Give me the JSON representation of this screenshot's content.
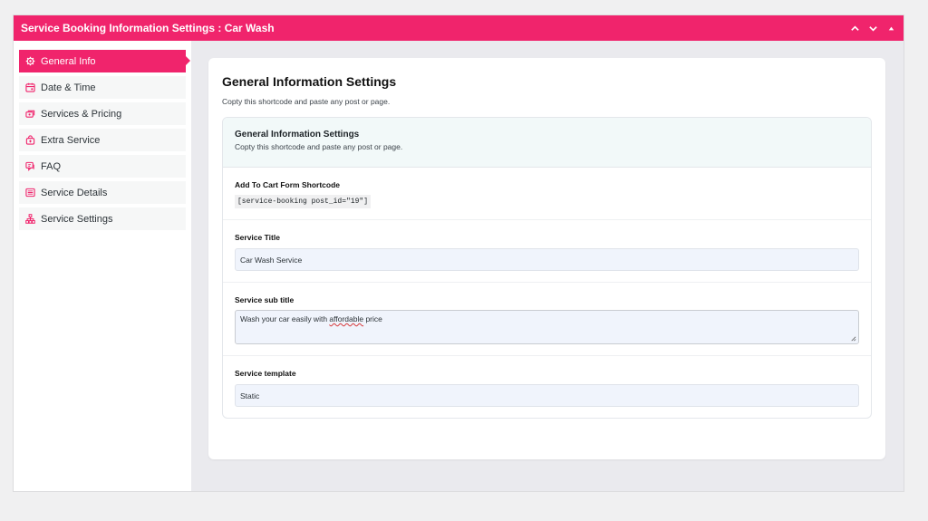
{
  "header": {
    "title": "Service Booking Information Settings : Car Wash",
    "accent": "#f0246c"
  },
  "sidebar": {
    "items": [
      {
        "label": "General Info",
        "icon": "gear-icon",
        "active": true
      },
      {
        "label": "Date & Time",
        "icon": "calendar-icon"
      },
      {
        "label": "Services & Pricing",
        "icon": "money-icon"
      },
      {
        "label": "Extra Service",
        "icon": "bag-icon"
      },
      {
        "label": "FAQ",
        "icon": "faq-icon"
      },
      {
        "label": "Service Details",
        "icon": "list-icon"
      },
      {
        "label": "Service Settings",
        "icon": "sitemap-icon"
      }
    ]
  },
  "card": {
    "title": "General Information Settings",
    "subtitle": "Copty this shortcode and paste any post or page.",
    "inner": {
      "title": "General Information Settings",
      "subtitle": "Copty this shortcode and paste any post or page."
    },
    "shortcode": {
      "label": "Add To Cart Form Shortcode",
      "value": "[service-booking post_id=\"19\"]"
    },
    "service_title": {
      "label": "Service Title",
      "value": "Car Wash Service"
    },
    "service_subtitle": {
      "label": "Service sub title",
      "value_before": "Wash your car easily with ",
      "value_misspelled": "affordable",
      "value_after": " price"
    },
    "service_template": {
      "label": "Service template",
      "value": "Static"
    }
  }
}
